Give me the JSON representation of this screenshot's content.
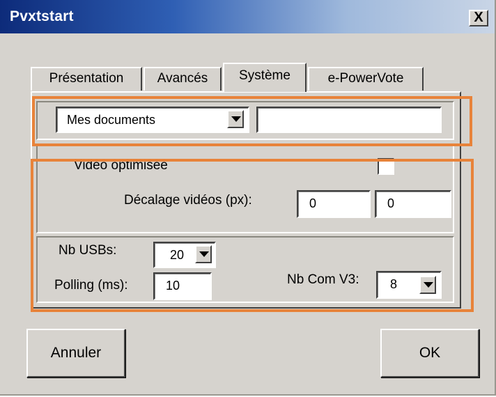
{
  "window": {
    "title": "Pvxtstart",
    "close_glyph": "X"
  },
  "tabs": [
    {
      "label": "Présentation"
    },
    {
      "label": "Avancés"
    },
    {
      "label": "Système"
    },
    {
      "label": "e-PowerVote"
    }
  ],
  "folder": {
    "selected": "Mes documents",
    "path_value": ""
  },
  "video": {
    "optimized_label": "Vidéo optimisée",
    "optimized_checked": false,
    "offset_label": "Décalage vidéos (px):",
    "offset_x": "0",
    "offset_y": "0"
  },
  "usb": {
    "count_label": "Nb USBs:",
    "count_value": "20",
    "polling_label": "Polling (ms):",
    "polling_value": "10",
    "com_label": "Nb Com V3:",
    "com_value": "8"
  },
  "buttons": {
    "cancel": "Annuler",
    "ok": "OK"
  },
  "colors": {
    "highlight": "#e8833a",
    "dialog_bg": "#d6d3ce",
    "title_start": "#0d2b7a"
  }
}
